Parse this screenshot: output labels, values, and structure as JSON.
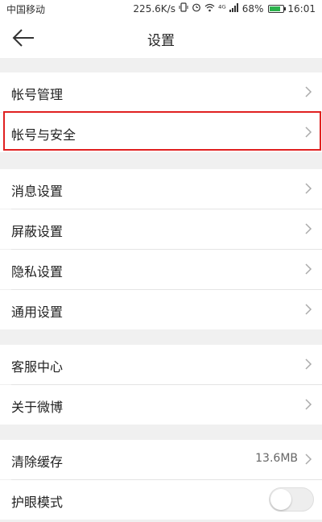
{
  "status_bar": {
    "carrier": "中国移动",
    "speed": "225.6K/s",
    "network": "⁴ᴳ",
    "battery_percent": "68%",
    "battery_level": 0.68,
    "time": "16:01",
    "icons": [
      "vibrate-icon",
      "alarm-icon",
      "wifi-icon",
      "signal-icon",
      "battery-icon"
    ]
  },
  "header": {
    "title": "设置",
    "back_icon": "arrow-left-icon"
  },
  "groups": [
    {
      "items": [
        {
          "label": "帐号管理"
        },
        {
          "label": "帐号与安全",
          "highlighted": true
        }
      ]
    },
    {
      "items": [
        {
          "label": "消息设置"
        },
        {
          "label": "屏蔽设置"
        },
        {
          "label": "隐私设置"
        },
        {
          "label": "通用设置"
        }
      ]
    },
    {
      "items": [
        {
          "label": "客服中心"
        },
        {
          "label": "关于微博"
        }
      ]
    },
    {
      "items": [
        {
          "label": "清除缓存",
          "value": "13.6MB"
        },
        {
          "label": "护眼模式",
          "toggle": false
        }
      ]
    }
  ],
  "colors": {
    "highlight_border": "#e02020",
    "background": "#f0f0f0",
    "row_background": "#ffffff",
    "battery_fill": "#2bb24c"
  }
}
